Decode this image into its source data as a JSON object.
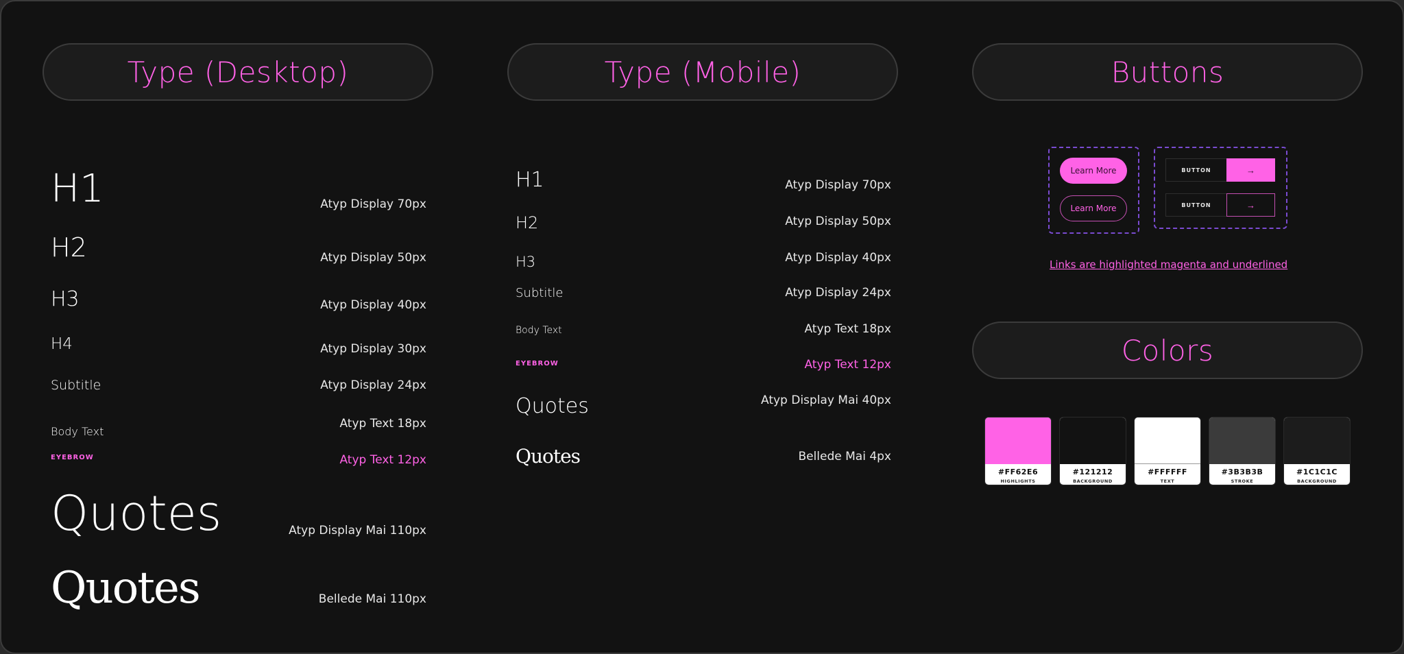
{
  "sections": {
    "desktop_title": "Type (Desktop)",
    "mobile_title": "Type (Mobile)",
    "buttons_title": "Buttons",
    "colors_title": "Colors"
  },
  "desktop": {
    "rows": [
      {
        "sample": "H1",
        "spec": "Atyp Display 70px"
      },
      {
        "sample": "H2",
        "spec": "Atyp Display 50px"
      },
      {
        "sample": "H3",
        "spec": "Atyp Display 40px"
      },
      {
        "sample": "H4",
        "spec": "Atyp Display 30px"
      },
      {
        "sample": "Subtitle",
        "spec": "Atyp Display 24px"
      },
      {
        "sample": "Body Text",
        "spec": "Atyp Text 18px"
      },
      {
        "sample": "EYEBROW",
        "spec": "Atyp Text 12px"
      },
      {
        "sample": "Quotes",
        "spec": "Atyp Display Mai 110px"
      },
      {
        "sample": "Quotes",
        "spec": "Bellede Mai 110px"
      }
    ]
  },
  "mobile": {
    "rows": [
      {
        "sample": "H1",
        "spec": "Atyp Display 70px"
      },
      {
        "sample": "H2",
        "spec": "Atyp Display 50px"
      },
      {
        "sample": "H3",
        "spec": "Atyp Display 40px"
      },
      {
        "sample": "Subtitle",
        "spec": "Atyp Display 24px"
      },
      {
        "sample": "Body Text",
        "spec": "Atyp Text 18px"
      },
      {
        "sample": "EYEBROW",
        "spec": "Atyp Text 12px"
      },
      {
        "sample": "Quotes",
        "spec": "Atyp Display Mai 40px"
      },
      {
        "sample": "Quotes",
        "spec": "Bellede Mai 4px"
      }
    ]
  },
  "buttons": {
    "pill_filled_label": "Learn More",
    "pill_outline_label": "Learn More",
    "split_filled_label": "BUTTON",
    "split_outline_label": "BUTTON",
    "arrow_glyph": "→",
    "link_text": "Links are highlighted magenta and underlined"
  },
  "colors": {
    "swatches": [
      {
        "hex": "#FF62E6",
        "name": "HIGHLIGHTS",
        "value": "#FF62E6"
      },
      {
        "hex": "#121212",
        "name": "BACKGROUND",
        "value": "#121212"
      },
      {
        "hex": "#FFFFFF",
        "name": "TEXT",
        "value": "#FFFFFF"
      },
      {
        "hex": "#3B3B3B",
        "name": "STROKE",
        "value": "#3B3B3B"
      },
      {
        "hex": "#1C1C1C",
        "name": "BACKGROUND",
        "value": "#1C1C1C"
      }
    ],
    "accent": "#FF62E6"
  }
}
